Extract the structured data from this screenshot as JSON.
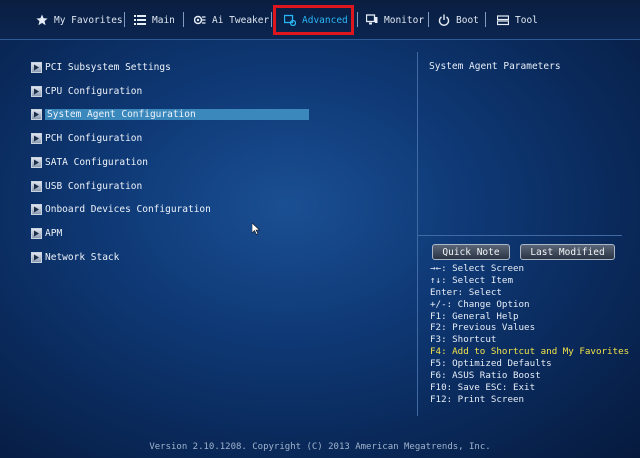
{
  "tabs": [
    {
      "label": "My Favorites",
      "icon": "star-icon"
    },
    {
      "label": "Main",
      "icon": "list-icon"
    },
    {
      "label": "Ai Tweaker",
      "icon": "tweaker-icon"
    },
    {
      "label": "Advanced",
      "icon": "advanced-icon",
      "active": true
    },
    {
      "label": "Monitor",
      "icon": "monitor-icon"
    },
    {
      "label": "Boot",
      "icon": "power-icon"
    },
    {
      "label": "Tool",
      "icon": "tool-icon"
    }
  ],
  "menu": {
    "items": [
      {
        "label": "PCI Subsystem Settings"
      },
      {
        "label": "CPU Configuration"
      },
      {
        "label": "System Agent Configuration",
        "selected": true
      },
      {
        "label": "PCH Configuration"
      },
      {
        "label": "SATA Configuration"
      },
      {
        "label": "USB Configuration"
      },
      {
        "label": "Onboard Devices Configuration"
      },
      {
        "label": "APM"
      },
      {
        "label": "Network Stack"
      }
    ]
  },
  "help": {
    "title": "System Agent Parameters",
    "quick_note": "Quick Note",
    "last_modified": "Last Modified",
    "keys": [
      "→←: Select Screen",
      "↑↓: Select Item",
      "Enter: Select",
      "+/-: Change Option",
      "F1: General Help",
      "F2: Previous Values",
      "F3: Shortcut",
      "F4: Add to Shortcut and My Favorites",
      "F5: Optimized Defaults",
      "F6: ASUS Ratio Boost",
      "F10: Save  ESC: Exit",
      "F12: Print Screen"
    ],
    "highlight_color": "#f1e24a"
  },
  "footer": "Version 2.10.1208. Copyright (C) 2013 American Megatrends, Inc.",
  "colors": {
    "accent": "#29b6f6",
    "selection": "#3b88bd",
    "annotation_box": "#e0161e"
  }
}
